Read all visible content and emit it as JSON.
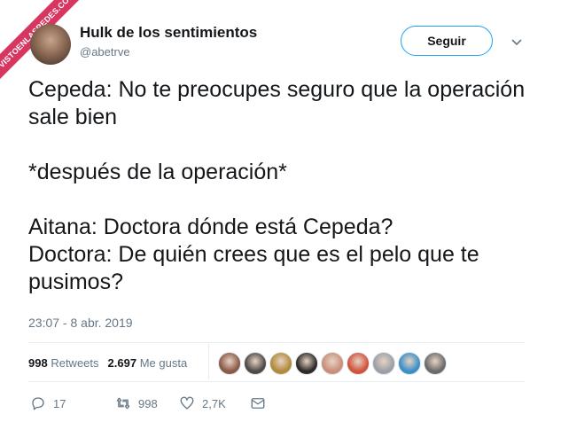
{
  "watermark": {
    "text": "VISTOENLASREDES.COM"
  },
  "author": {
    "name": "Hulk de los sentimientos",
    "handle": "@abetrve"
  },
  "follow_button": {
    "label": "Seguir"
  },
  "tweet": {
    "lines": [
      "Cepeda: No te preocupes seguro que la operación sale bien",
      "*después de la operación*",
      "Aitana: Doctora dónde está Cepeda?",
      "Doctora: De quién crees que es el pelo que te pusimos?"
    ]
  },
  "timestamp": "23:07 - 8 abr. 2019",
  "stats": {
    "retweets_count": "998",
    "retweets_label": "Retweets",
    "likes_count": "2.697",
    "likes_label": "Me gusta"
  },
  "liker_colors": [
    "#8a5a4a",
    "#4e4a47",
    "#b28a3c",
    "#2d2a28",
    "#c98f7a",
    "#d0533c",
    "#9aa0a6",
    "#3a8fc7",
    "#6b6b6b"
  ],
  "actions": {
    "replies": "17",
    "retweets": "998",
    "likes": "2,7K"
  },
  "colors": {
    "accent": "#1da1f2",
    "muted": "#657786"
  }
}
